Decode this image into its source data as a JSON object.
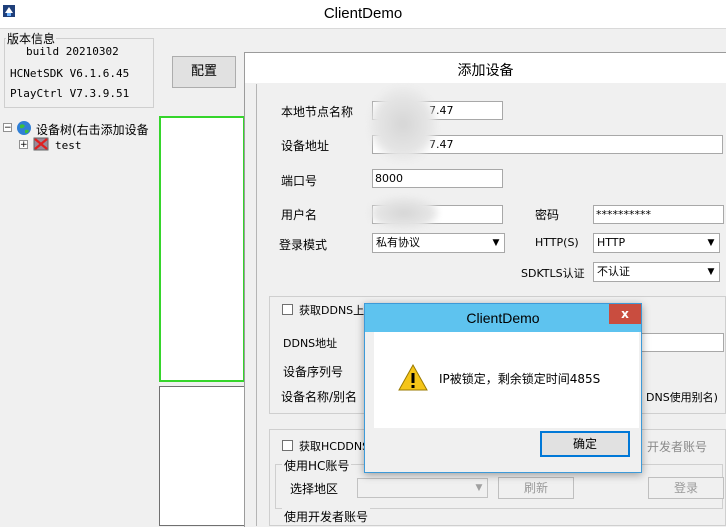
{
  "main_window": {
    "title": "ClientDemo",
    "version_group_label": "版本信息",
    "build": "build 20210302",
    "sdk_version": "HCNetSDK V6.1.6.45",
    "playctrl_version": "PlayCtrl V7.3.9.51",
    "config_button": "配置",
    "tree": {
      "root_label": "设备树(右击添加设备",
      "child_label": "test"
    }
  },
  "add_device_dialog": {
    "title": "添加设备",
    "local_node_name_label": "本地节点名称",
    "local_node_name_value": "7.47",
    "device_address_label": "设备地址",
    "device_address_value": "7.47",
    "port_label": "端口号",
    "port_value": "8000",
    "username_label": "用户名",
    "password_label": "密码",
    "password_value": "**********",
    "login_mode_label": "登录模式",
    "login_mode_value": "私有协议",
    "http_label": "HTTP(S)",
    "http_value": "HTTP",
    "sdktls_label": "SDKTLS认证",
    "sdktls_value": "不认证",
    "ddns_checkbox_label": "获取DDNS上传",
    "ddns_address_label": "DDNS地址",
    "serial_label": "设备序列号",
    "device_name_label": "设备名称/别名",
    "ddns_alias_text": "DNS使用别名)",
    "hcddns_checkbox_label": "获取HCDDNS_",
    "developer_account_text": "开发者账号",
    "use_hc_account_label": "使用HC账号",
    "select_region_label": "选择地区",
    "refresh_button": "刷新",
    "login_button": "登录",
    "use_developer_account_label": "使用开发者账号"
  },
  "message_box": {
    "title": "ClientDemo",
    "close_symbol": "x",
    "message": "IP被锁定，剩余锁定时间485S",
    "ok_button": "确定"
  },
  "colors": {
    "message_title_bar": "#5ec3ef",
    "close_button": "#c94d3f",
    "preview_border": "#35d52b"
  }
}
